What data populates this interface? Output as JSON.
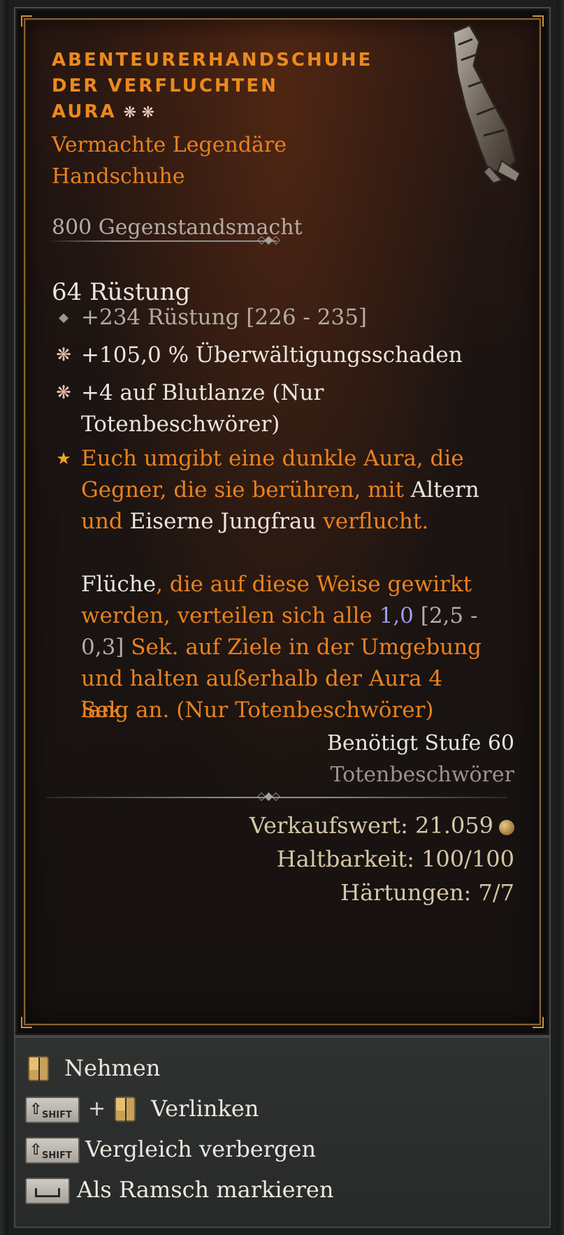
{
  "item": {
    "title_lines": [
      "Abenteurerhandschuhe",
      "der verfluchten",
      "Aura"
    ],
    "title_stars": "❋ ❋",
    "type_line_1": "Vermachte Legendäre",
    "type_line_2": "Handschuhe",
    "item_power": "800 Gegenstandsmacht",
    "armor": "64 Rüstung",
    "affixes": [
      {
        "icon": "diamond-icon",
        "text": "+234 Rüstung [226 - 235]"
      },
      {
        "icon": "greater-affix-icon",
        "text": "+105,0 % Überwältigungsschaden"
      },
      {
        "icon": "greater-affix-icon",
        "text_1": "+4 auf Blutlanze (Nur",
        "text_2": "Totenbeschwörer)"
      }
    ],
    "aspect": {
      "icon": "legendary-star-icon",
      "p1_a": "Euch umgibt eine dunkle Aura, die",
      "p1_b": "Gegner, die sie berühren, mit ",
      "p1_c": "Altern",
      "p1_d": "und ",
      "p1_e": "Eiserne Jungfrau",
      "p1_f": " verflucht.",
      "p2_a": "Flüche",
      "p2_b": ", die auf diese Weise gewirkt",
      "p2_c": "werden, verteilen sich alle ",
      "p2_d": "1,0",
      "p2_e": " [2,5 -",
      "p2_f": "0,3]",
      "p2_g": " Sek. auf Ziele in der Umgebung",
      "p2_h": "und halten außerhalb der Aura 4 Sek.",
      "p2_i": "lang an. (Nur Totenbeschwörer)"
    },
    "required_level": "Benötigt Stufe 60",
    "required_class": "Totenbeschwörer",
    "sell_value": "Verkaufswert: 21.059",
    "durability": "Haltbarkeit: 100/100",
    "tempers": "Härtungen: 7/7"
  },
  "actions": {
    "take": "Nehmen",
    "link_plus": "+",
    "link": "Verlinken",
    "hide_compare": "Vergleich verbergen",
    "mark_junk": "Als Ramsch markieren",
    "shift_key": "SHIFT"
  },
  "colors": {
    "legendary_orange": "#e8821f",
    "title_orange": "#eb8a1d",
    "value_blue": "#9e9df0",
    "frame_gold": "#8a6234"
  }
}
